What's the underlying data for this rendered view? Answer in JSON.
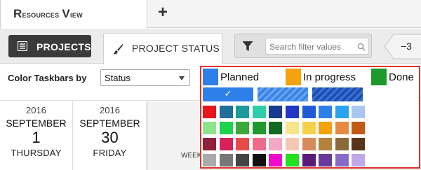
{
  "tabs": {
    "view_title_cap": "R",
    "view_title_rest": "esources ",
    "view_title_cap2": "V",
    "view_title_rest2": "iew",
    "add_label": "+"
  },
  "toolbar": {
    "projects_label": "PROJECTS",
    "project_status_label": "PROJECT STATUS",
    "filter_placeholder": "Search filter values",
    "zoom_label": "−3"
  },
  "options": {
    "color_by_label": "Color Taskbars by",
    "color_by_value": "Status"
  },
  "dates": [
    {
      "year": "2016",
      "month": "SEPTEMBER",
      "day": "1",
      "weekday": "THURSDAY"
    },
    {
      "year": "2016",
      "month": "SEPTEMBER",
      "day": "30",
      "weekday": "FRIDAY"
    }
  ],
  "timeline": {
    "week_label": "WEEK"
  },
  "color_popup": {
    "legend": [
      {
        "label": "Planned",
        "color": "#2f7fe8"
      },
      {
        "label": "In progress",
        "color": "#f4a30e"
      },
      {
        "label": "Done",
        "color": "#1e9a2c"
      }
    ],
    "selected_pattern_mark": "✓",
    "palette": [
      [
        "#e8161c",
        "#1f6f9a",
        "#1a9a9a",
        "#2ecfa8",
        "#163b8f",
        "#2036c4",
        "#1e5ad6",
        "#2f7fe8",
        "#2aa3ee",
        "#a9c8f0"
      ],
      [
        "#8ee48a",
        "#1ed24c",
        "#3aa83a",
        "#1e9a2c",
        "#126a22",
        "#f6e58a",
        "#f7d04a",
        "#f4a30e",
        "#e58a3e",
        "#c45a18"
      ],
      [
        "#8f1f3a",
        "#d8205a",
        "#e84a4a",
        "#f06a8a",
        "#f4a8c4",
        "#f6c8b4",
        "#d88a5a",
        "#b4823a",
        "#8a6a3a",
        "#5a3418"
      ],
      [
        "#aaaaaa",
        "#777777",
        "#444444",
        "#111111",
        "#f00acb",
        "#23e020",
        "#5a1a7a",
        "#6a3a9a",
        "#8a6ac8",
        "#c0a8e8"
      ]
    ]
  }
}
